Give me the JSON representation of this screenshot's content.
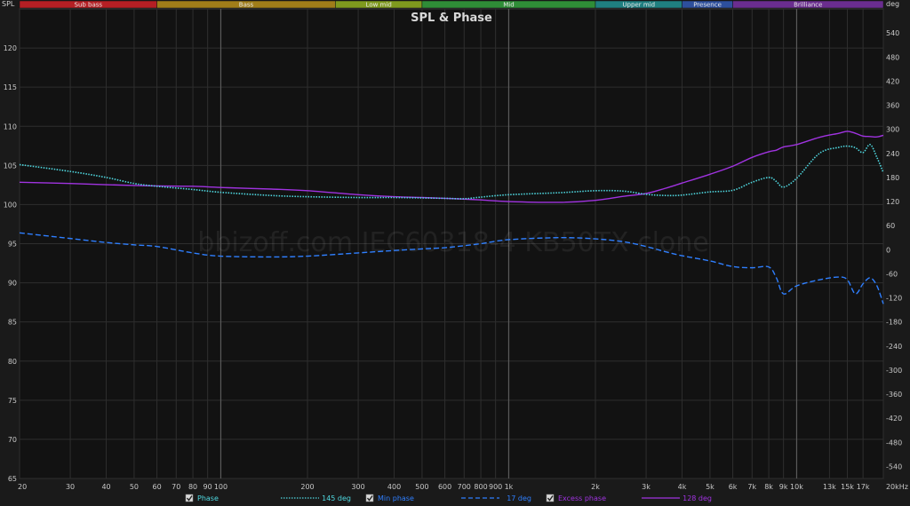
{
  "chart_data": {
    "type": "line",
    "title": "SPL & Phase",
    "watermark": "bbizoff.com IEC60318-4 KB50TX clone",
    "left_axis": {
      "label": "SPL",
      "min": 65,
      "max": 125,
      "ticks": [
        65,
        70,
        75,
        80,
        85,
        90,
        95,
        100,
        105,
        110,
        115,
        120
      ]
    },
    "right_axis": {
      "label": "deg",
      "min": -570,
      "max": 600,
      "ticks": [
        -540,
        -480,
        -420,
        -360,
        -300,
        -240,
        -180,
        -120,
        -60,
        0,
        60,
        120,
        180,
        240,
        300,
        360,
        420,
        480,
        540
      ]
    },
    "x_axis": {
      "label": "Hz",
      "scale": "log",
      "min": 20,
      "max": 20000,
      "major_ticks": [
        100,
        1000,
        10000
      ],
      "tick_values": [
        20,
        30,
        40,
        50,
        60,
        70,
        80,
        90,
        100,
        200,
        300,
        400,
        500,
        600,
        700,
        800,
        900,
        1000,
        2000,
        3000,
        4000,
        5000,
        6000,
        7000,
        8000,
        9000,
        10000,
        13000,
        15000,
        17000,
        20000
      ],
      "tick_labels": [
        "20",
        "30",
        "40",
        "50",
        "60",
        "70",
        "80",
        "90",
        "100",
        "200",
        "300",
        "400",
        "500",
        "600",
        "700",
        "800",
        "900",
        "1k",
        "2k",
        "3k",
        "4k",
        "5k",
        "6k",
        "7k",
        "8k",
        "9k",
        "10k",
        "13k",
        "15k",
        "17k",
        "20kHz"
      ]
    },
    "bands": [
      {
        "name": "Sub bass",
        "from": 20,
        "to": 60,
        "color": "#b51f24"
      },
      {
        "name": "Bass",
        "from": 60,
        "to": 250,
        "color": "#a07d19"
      },
      {
        "name": "Low mid",
        "from": 250,
        "to": 500,
        "color": "#7f9a1e"
      },
      {
        "name": "Mid",
        "from": 500,
        "to": 2000,
        "color": "#2f8d37"
      },
      {
        "name": "Upper mid",
        "from": 2000,
        "to": 4000,
        "color": "#1f7f80"
      },
      {
        "name": "Presence",
        "from": 4000,
        "to": 6000,
        "color": "#2d4f9c"
      },
      {
        "name": "Brilliance",
        "from": 6000,
        "to": 20000,
        "color": "#6a2d8f"
      }
    ],
    "series": [
      {
        "name": "Phase",
        "legend_value": "145 deg",
        "axis": "right",
        "color": "#4fd8e0",
        "style": "dotted",
        "x": [
          20,
          30,
          40,
          50,
          60,
          80,
          100,
          150,
          200,
          300,
          400,
          500,
          600,
          700,
          800,
          1000,
          1500,
          2000,
          2500,
          3000,
          3500,
          4000,
          5000,
          6000,
          7000,
          8000,
          8500,
          9000,
          10000,
          12000,
          14000,
          15000,
          16000,
          17000,
          18000,
          19000,
          20000
        ],
        "y": [
          212,
          195,
          180,
          165,
          158,
          150,
          143,
          135,
          132,
          130,
          130,
          129,
          128,
          127,
          131,
          137,
          142,
          147,
          146,
          138,
          135,
          136,
          144,
          148,
          168,
          180,
          170,
          156,
          178,
          240,
          255,
          258,
          254,
          242,
          262,
          230,
          192
        ]
      },
      {
        "name": "Min phase",
        "legend_value": "17 deg",
        "axis": "right",
        "color": "#2f7fff",
        "style": "dashed",
        "x": [
          20,
          30,
          40,
          50,
          60,
          80,
          100,
          150,
          200,
          300,
          400,
          500,
          600,
          700,
          800,
          1000,
          1500,
          2000,
          2500,
          3000,
          3500,
          4000,
          5000,
          6000,
          7000,
          8000,
          8500,
          9000,
          10000,
          12000,
          14000,
          15000,
          16000,
          17000,
          18000,
          19000,
          20000
        ],
        "y": [
          42,
          28,
          18,
          12,
          8,
          -8,
          -16,
          -18,
          -16,
          -8,
          -2,
          2,
          5,
          10,
          15,
          25,
          30,
          27,
          20,
          8,
          -5,
          -15,
          -28,
          -42,
          -45,
          -43,
          -70,
          -110,
          -90,
          -75,
          -68,
          -75,
          -110,
          -85,
          -70,
          -90,
          -135
        ]
      },
      {
        "name": "Excess phase",
        "legend_value": "128 deg",
        "axis": "right",
        "color": "#a033e0",
        "style": "solid",
        "x": [
          20,
          30,
          40,
          50,
          60,
          80,
          100,
          150,
          200,
          300,
          400,
          500,
          600,
          700,
          800,
          1000,
          1500,
          2000,
          2500,
          3000,
          3500,
          4000,
          5000,
          6000,
          7000,
          8000,
          8500,
          9000,
          10000,
          12000,
          14000,
          15000,
          16000,
          17000,
          18000,
          19000,
          20000
        ],
        "y": [
          168,
          165,
          162,
          160,
          159,
          158,
          155,
          151,
          147,
          137,
          132,
          130,
          128,
          126,
          124,
          120,
          118,
          123,
          133,
          140,
          153,
          166,
          188,
          208,
          230,
          244,
          248,
          256,
          262,
          280,
          290,
          295,
          290,
          283,
          282,
          281,
          285
        ]
      }
    ],
    "legend": [
      {
        "label": "Phase",
        "value": "145 deg",
        "checked": true
      },
      {
        "label": "Min phase",
        "value": "17 deg",
        "checked": true
      },
      {
        "label": "Excess phase",
        "value": "128 deg",
        "checked": true
      }
    ],
    "grid": true,
    "legend_placement": "bottom"
  }
}
